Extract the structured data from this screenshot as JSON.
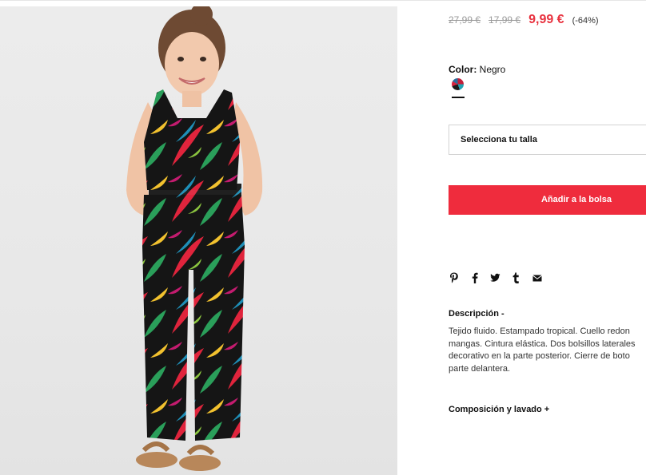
{
  "product": {
    "image_alt": "Girl wearing black tropical print jumpsuit"
  },
  "price": {
    "original": "27,99 €",
    "previous": "17,99 €",
    "current": "9,99 €",
    "discount": "(-64%)"
  },
  "color": {
    "label": "Color:",
    "value": "Negro"
  },
  "size_select": {
    "placeholder": "Selecciona tu talla"
  },
  "actions": {
    "add_to_bag": "Añadir a la bolsa"
  },
  "share": {
    "icons": [
      "pinterest-icon",
      "facebook-icon",
      "twitter-icon",
      "tumblr-icon",
      "email-icon"
    ]
  },
  "description": {
    "heading": "Descripción -",
    "lines": [
      "Tejido fluido. Estampado tropical. Cuello redon",
      "mangas. Cintura elástica. Dos bolsillos laterales",
      "decorativo en la parte posterior. Cierre de boto",
      "parte delantera."
    ]
  },
  "composition": {
    "heading": "Composición y lavado +"
  },
  "theme": {
    "accent": "#ef2c3d",
    "price_color": "#e8323f"
  }
}
